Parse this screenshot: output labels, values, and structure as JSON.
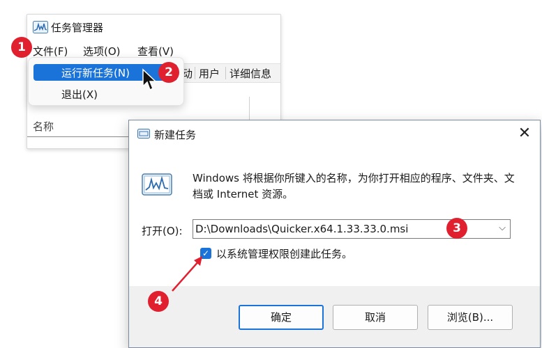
{
  "task_manager": {
    "title": "任务管理器",
    "menu": [
      "文件(F)",
      "选项(O)",
      "查看(V)"
    ],
    "tabs": [
      "动",
      "用户",
      "详细信息"
    ],
    "column_name": "名称"
  },
  "file_menu": {
    "run_new_task": "运行新任务(N)",
    "exit": "退出(X)"
  },
  "dialog": {
    "title": "新建任务",
    "close": "✕",
    "description": "Windows 将根据你所键入的名称，为你打开相应的程序、文件夹、文档或 Internet 资源。",
    "open_label": "打开(O):",
    "open_value": "D:\\Downloads\\Quicker.x64.1.33.33.0.msi",
    "admin_checkbox_label": "以系统管理权限创建此任务。",
    "admin_checked": true,
    "buttons": {
      "ok": "确定",
      "cancel": "取消",
      "browse": "浏览(B)..."
    }
  },
  "badges": [
    "1",
    "2",
    "3",
    "4"
  ],
  "colors": {
    "accent": "#1a73d9",
    "badge": "#e0202e",
    "annotation_arrow": "#e0202e"
  },
  "icons": [
    "task-manager-icon",
    "cursor-arrow-icon",
    "close-icon",
    "chevron-down-icon",
    "checkmark-icon"
  ]
}
